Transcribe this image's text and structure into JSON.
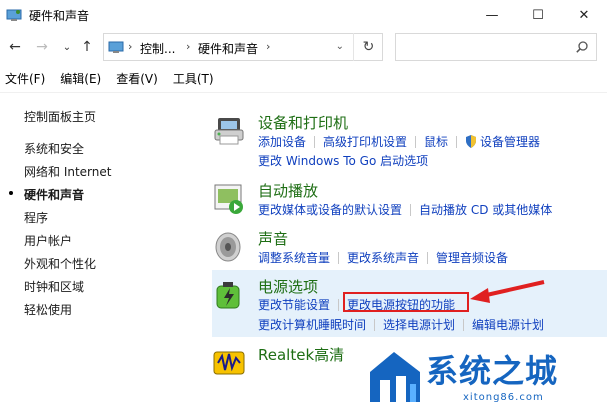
{
  "window": {
    "title": "硬件和声音",
    "minimize_label": "—",
    "maximize_label": "☐",
    "close_label": "✕"
  },
  "address": {
    "back_label": "←",
    "forward_label": "→",
    "recent_label": "⌄",
    "up_label": "↑",
    "crumbs": [
      "控制...",
      "硬件和声音"
    ],
    "sep": "›",
    "dropdown_label": "⌄",
    "refresh_label": "↻",
    "search_placeholder": ""
  },
  "menu": [
    "文件(F)",
    "编辑(E)",
    "查看(V)",
    "工具(T)"
  ],
  "sidebar": {
    "items": [
      {
        "label": "控制面板主页"
      },
      {
        "label": "系统和安全"
      },
      {
        "label": "网络和 Internet"
      },
      {
        "label": "硬件和声音",
        "active": true
      },
      {
        "label": "程序"
      },
      {
        "label": "用户帐户"
      },
      {
        "label": "外观和个性化"
      },
      {
        "label": "时钟和区域"
      },
      {
        "label": "轻松使用"
      }
    ]
  },
  "categories": [
    {
      "title": "设备和打印机",
      "icon": "printer-icon",
      "rows": [
        [
          "添加设备",
          "高级打印机设置",
          "鼠标",
          "设备管理器"
        ],
        [
          "更改 Windows To Go 启动选项"
        ]
      ]
    },
    {
      "title": "自动播放",
      "icon": "autoplay-icon",
      "rows": [
        [
          "更改媒体或设备的默认设置",
          "自动播放 CD 或其他媒体"
        ]
      ]
    },
    {
      "title": "声音",
      "icon": "speaker-icon",
      "rows": [
        [
          "调整系统音量",
          "更改系统声音",
          "管理音频设备"
        ]
      ]
    },
    {
      "title": "电源选项",
      "icon": "battery-icon",
      "rows": [
        [
          "更改节能设置",
          "更改电源按钮的功能"
        ],
        [
          "更改计算机睡眠时间",
          "选择电源计划",
          "编辑电源计划"
        ]
      ]
    },
    {
      "title": "Realtek高清",
      "icon": "realtek-audio-icon",
      "rows": []
    }
  ],
  "watermark": {
    "main": "系统之城",
    "sub": "xitong86.com"
  },
  "colors": {
    "link": "#0f3fbe",
    "title": "#1e6e14",
    "highlight": "#e5f1fb",
    "annotation": "#e02020",
    "watermark": "#1565c0"
  }
}
